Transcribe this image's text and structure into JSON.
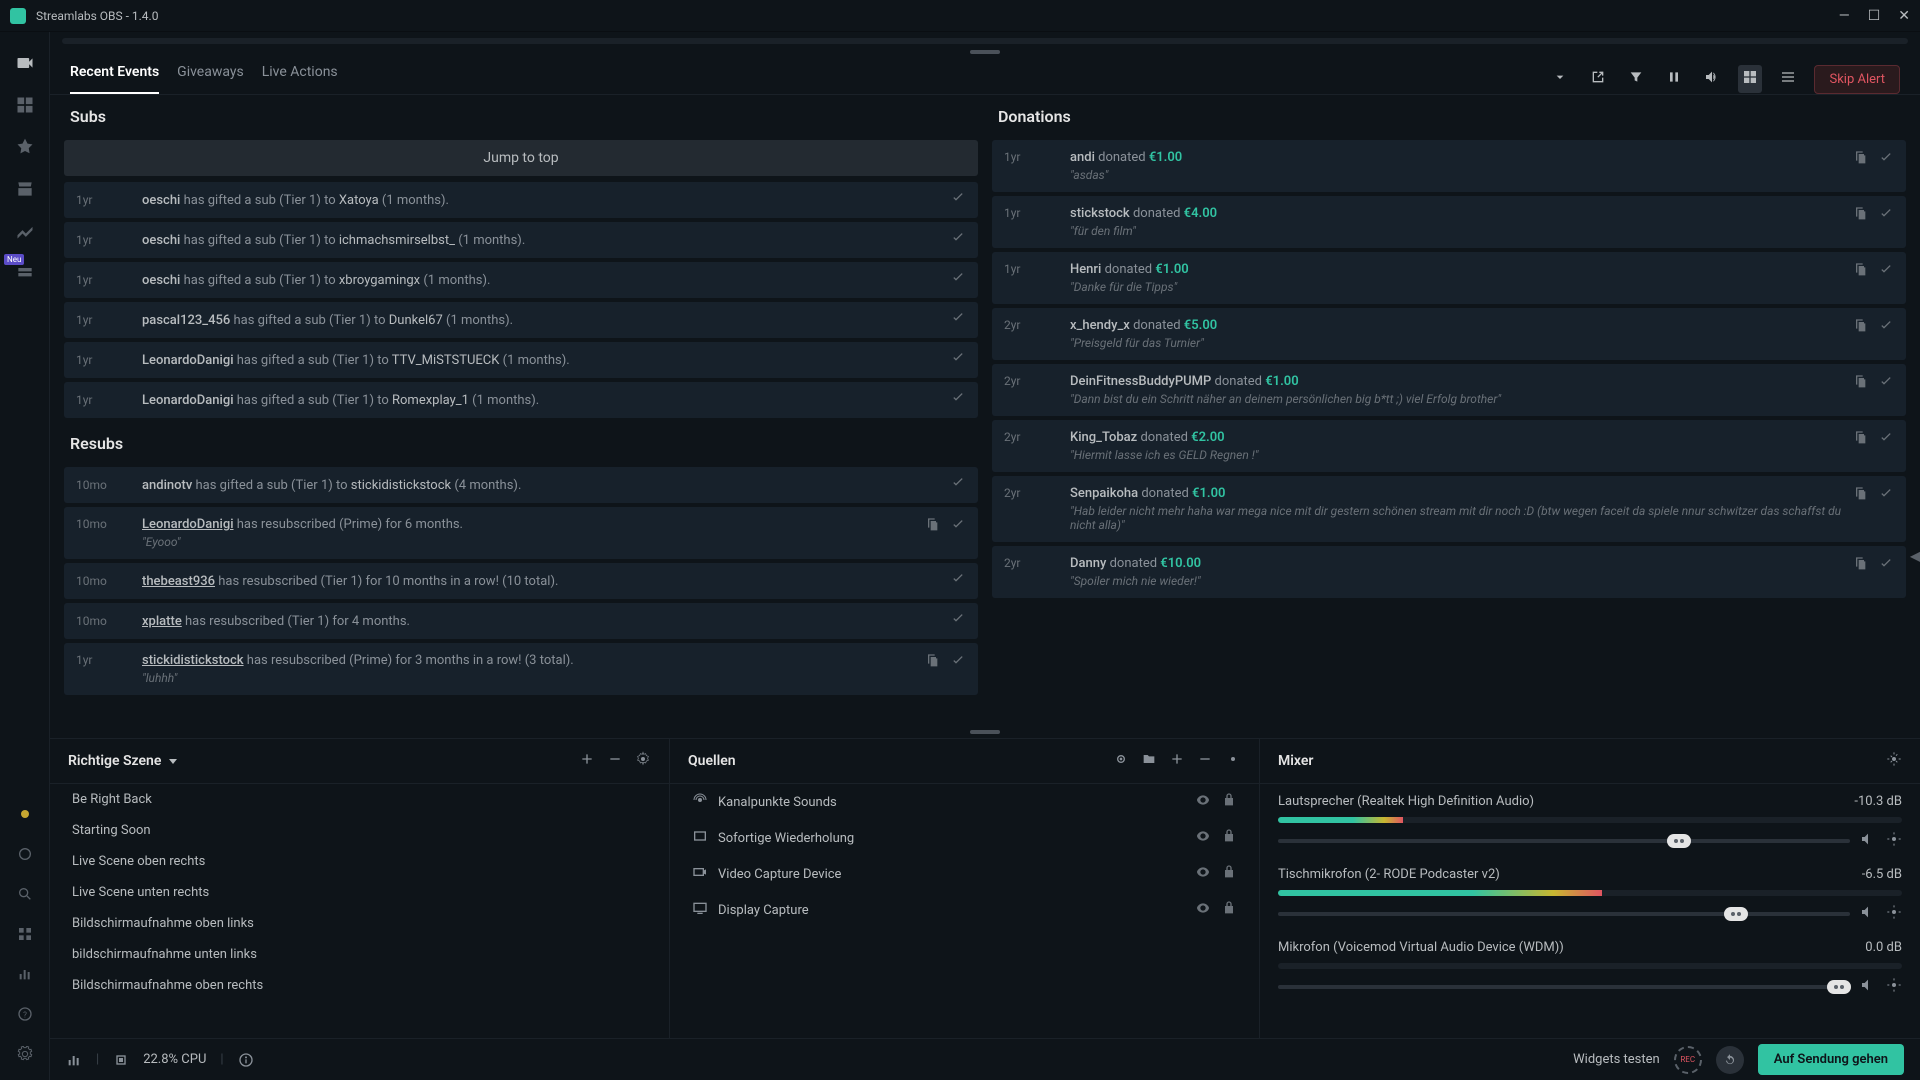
{
  "app": {
    "title": "Streamlabs OBS - 1.4.0",
    "neu_badge": "Neu"
  },
  "tabs": {
    "items": [
      "Recent Events",
      "Giveaways",
      "Live Actions"
    ],
    "skip_alert": "Skip Alert"
  },
  "subs": {
    "title": "Subs",
    "jump": "Jump to top",
    "items": [
      {
        "time": "1yr",
        "user": "oeschi",
        "mid": "has gifted a sub (Tier 1) to",
        "target": "Xatoya",
        "dur": "(1 months)."
      },
      {
        "time": "1yr",
        "user": "oeschi",
        "mid": "has gifted a sub (Tier 1) to",
        "target": "ichmachsmirselbst_",
        "dur": "(1 months)."
      },
      {
        "time": "1yr",
        "user": "oeschi",
        "mid": "has gifted a sub (Tier 1) to",
        "target": "xbroygamingx",
        "dur": "(1 months)."
      },
      {
        "time": "1yr",
        "user": "pascal123_456",
        "mid": "has gifted a sub (Tier 1) to",
        "target": "Dunkel67",
        "dur": "(1 months)."
      },
      {
        "time": "1yr",
        "user": "LeonardoDanigi",
        "mid": "has gifted a sub (Tier 1) to",
        "target": "TTV_MiSTSTUECK",
        "dur": "(1 months)."
      },
      {
        "time": "1yr",
        "user": "LeonardoDanigi",
        "mid": "has gifted a sub (Tier 1) to",
        "target": "Romexplay_1",
        "dur": "(1 months)."
      }
    ]
  },
  "resubs": {
    "title": "Resubs",
    "items": [
      {
        "time": "10mo",
        "user": "andinotv",
        "rest": "has gifted a sub (Tier 1) to",
        "target": "stickidistickstock",
        "dur": "(4 months).",
        "msg": ""
      },
      {
        "time": "10mo",
        "user": "LeonardoDanigi",
        "rest": "has resubscribed (Prime) for 6 months.",
        "target": "",
        "dur": "",
        "msg": "\"Eyooo\""
      },
      {
        "time": "10mo",
        "user": "thebeast936",
        "rest": "has resubscribed (Tier 1) for 10 months in a row! (10 total).",
        "target": "",
        "dur": "",
        "msg": ""
      },
      {
        "time": "10mo",
        "user": "xplatte",
        "rest": "has resubscribed (Tier 1) for 4 months.",
        "target": "",
        "dur": "",
        "msg": ""
      },
      {
        "time": "1yr",
        "user": "stickidistickstock",
        "rest": "has resubscribed (Prime) for 3 months in a row! (3 total).",
        "target": "",
        "dur": "",
        "msg": "\"luhhh\""
      }
    ]
  },
  "donations": {
    "title": "Donations",
    "items": [
      {
        "time": "1yr",
        "user": "andi",
        "verb": "donated",
        "amt": "€1.00",
        "msg": "\"asdas\""
      },
      {
        "time": "1yr",
        "user": "stickstock",
        "verb": "donated",
        "amt": "€4.00",
        "msg": "\"für den film\""
      },
      {
        "time": "1yr",
        "user": "Henri",
        "verb": "donated",
        "amt": "€1.00",
        "msg": "\"Danke für die Tipps\""
      },
      {
        "time": "2yr",
        "user": "x_hendy_x",
        "verb": "donated",
        "amt": "€5.00",
        "msg": "\"Preisgeld für das Turnier\""
      },
      {
        "time": "2yr",
        "user": "DeinFitnessBuddyPUMP",
        "verb": "donated",
        "amt": "€1.00",
        "msg": "\"Dann bist du ein Schritt näher an deinem persönlichen big b*tt ;) viel Erfolg brother\""
      },
      {
        "time": "2yr",
        "user": "King_Tobaz",
        "verb": "donated",
        "amt": "€2.00",
        "msg": "\"Hiermit lasse ich es GELD Regnen !\""
      },
      {
        "time": "2yr",
        "user": "Senpaikoha",
        "verb": "donated",
        "amt": "€1.00",
        "msg": "\"Hab leider nicht mehr haha war mega nice mit dir gestern schönen stream mit dir noch :D (btw wegen faceit da spiele nnur schwitzer das schaffst du nicht alla)\""
      },
      {
        "time": "2yr",
        "user": "Danny",
        "verb": "donated",
        "amt": "€10.00",
        "msg": "\"Spoiler mich nie wieder!\""
      }
    ]
  },
  "scenes": {
    "title": "Richtige Szene",
    "items": [
      "Be Right Back",
      "Starting Soon",
      "Live Scene oben rechts",
      "Live Scene unten rechts",
      "Bildschirmaufnahme oben links",
      "bildschirmaufnahme unten links",
      "Bildschirmaufnahme oben rechts"
    ]
  },
  "sources": {
    "title": "Quellen",
    "items": [
      {
        "name": "Kanalpunkte Sounds",
        "icon": "sound"
      },
      {
        "name": "Sofortige Wiederholung",
        "icon": "replay"
      },
      {
        "name": "Video Capture Device",
        "icon": "camera"
      },
      {
        "name": "Display Capture",
        "icon": "display"
      }
    ]
  },
  "mixer": {
    "title": "Mixer",
    "items": [
      {
        "name": "Lautsprecher (Realtek High Definition Audio)",
        "db": "-10.3 dB",
        "level": 20,
        "thumb": 68
      },
      {
        "name": "Tischmikrofon (2- RODE Podcaster v2)",
        "db": "-6.5 dB",
        "level": 52,
        "thumb": 78
      },
      {
        "name": "Mikrofon (Voicemod Virtual Audio Device (WDM))",
        "db": "0.0 dB",
        "level": 0,
        "thumb": 96
      }
    ]
  },
  "status": {
    "cpu": "22.8% CPU",
    "widgets": "Widgets testen",
    "rec": "REC",
    "golive": "Auf Sendung gehen"
  }
}
